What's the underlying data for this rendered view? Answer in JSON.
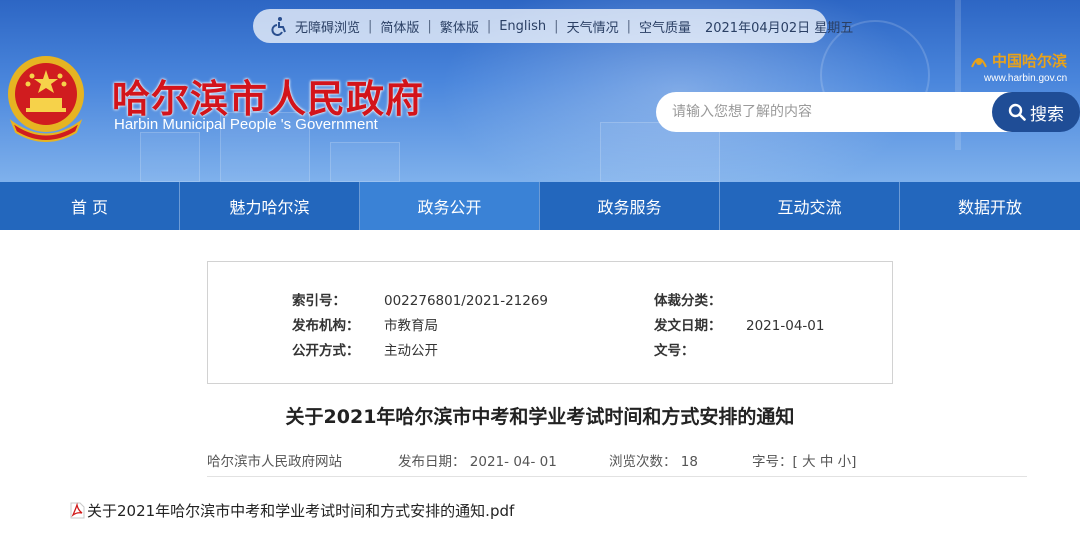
{
  "topbar": {
    "items": [
      "无障碍浏览",
      "简体版",
      "繁体版",
      "English",
      "天气情况",
      "空气质量"
    ],
    "date": "2021年04月02日 星期五"
  },
  "header": {
    "title_cn": "哈尔滨市人民政府",
    "title_en": "Harbin Municipal People 's Government",
    "brand_cn": "中国哈尔滨",
    "brand_url": "www.harbin.gov.cn"
  },
  "search": {
    "placeholder": "请输入您想了解的内容",
    "button_label": "搜索"
  },
  "nav": {
    "items": [
      "首 页",
      "魅力哈尔滨",
      "政务公开",
      "政务服务",
      "互动交流",
      "数据开放"
    ],
    "active_index": 2
  },
  "meta": {
    "index_label": "索引号：",
    "index_value": "002276801/2021-21269",
    "org_label": "发布机构：",
    "org_value": "市教育局",
    "open_label": "公开方式：",
    "open_value": "主动公开",
    "genre_label": "体裁分类：",
    "genre_value": "",
    "date_label": "发文日期：",
    "date_value": "2021-04-01",
    "docno_label": "文号：",
    "docno_value": ""
  },
  "article": {
    "title": "关于2021年哈尔滨市中考和学业考试时间和方式安排的通知",
    "source": "哈尔滨市人民政府网站",
    "publish_label": "发布日期：",
    "publish_date": "2021- 04- 01",
    "views_label": "浏览次数：",
    "views": "18",
    "fontsize_label": "字号：[",
    "fontsize_large": "大",
    "fontsize_medium": "中",
    "fontsize_small": "小",
    "fontsize_close": "]"
  },
  "attachment": {
    "filename": "关于2021年哈尔滨市中考和学业考试时间和方式安排的通知.pdf"
  },
  "colors": {
    "nav_bg": "#2367bd",
    "nav_active": "#3a82d6",
    "title_red": "#d3141b",
    "search_button": "#1f4d96"
  }
}
